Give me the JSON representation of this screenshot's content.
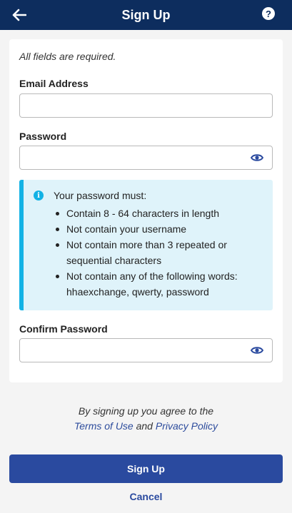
{
  "header": {
    "title": "Sign Up",
    "help_glyph": "?"
  },
  "form": {
    "required_note": "All fields are required.",
    "email": {
      "label": "Email Address",
      "value": ""
    },
    "password": {
      "label": "Password",
      "value": ""
    },
    "confirm_password": {
      "label": "Confirm Password",
      "value": ""
    }
  },
  "password_rules": {
    "title": "Your password must:",
    "items": [
      "Contain 8 - 64 characters in length",
      "Not contain your username",
      "Not contain more than 3 repeated or sequential characters",
      "Not contain any of the following words: hhaexchange, qwerty, password"
    ]
  },
  "agreement": {
    "prefix": "By signing up you agree to the",
    "terms_link": "Terms of Use",
    "and": "and",
    "privacy_link": "Privacy Policy"
  },
  "actions": {
    "signup_label": "Sign Up",
    "cancel_label": "Cancel"
  },
  "colors": {
    "header_bg": "#0d2d5e",
    "primary": "#2a4a9f",
    "info_bg": "#dff3fa",
    "info_accent": "#12b2e5"
  }
}
